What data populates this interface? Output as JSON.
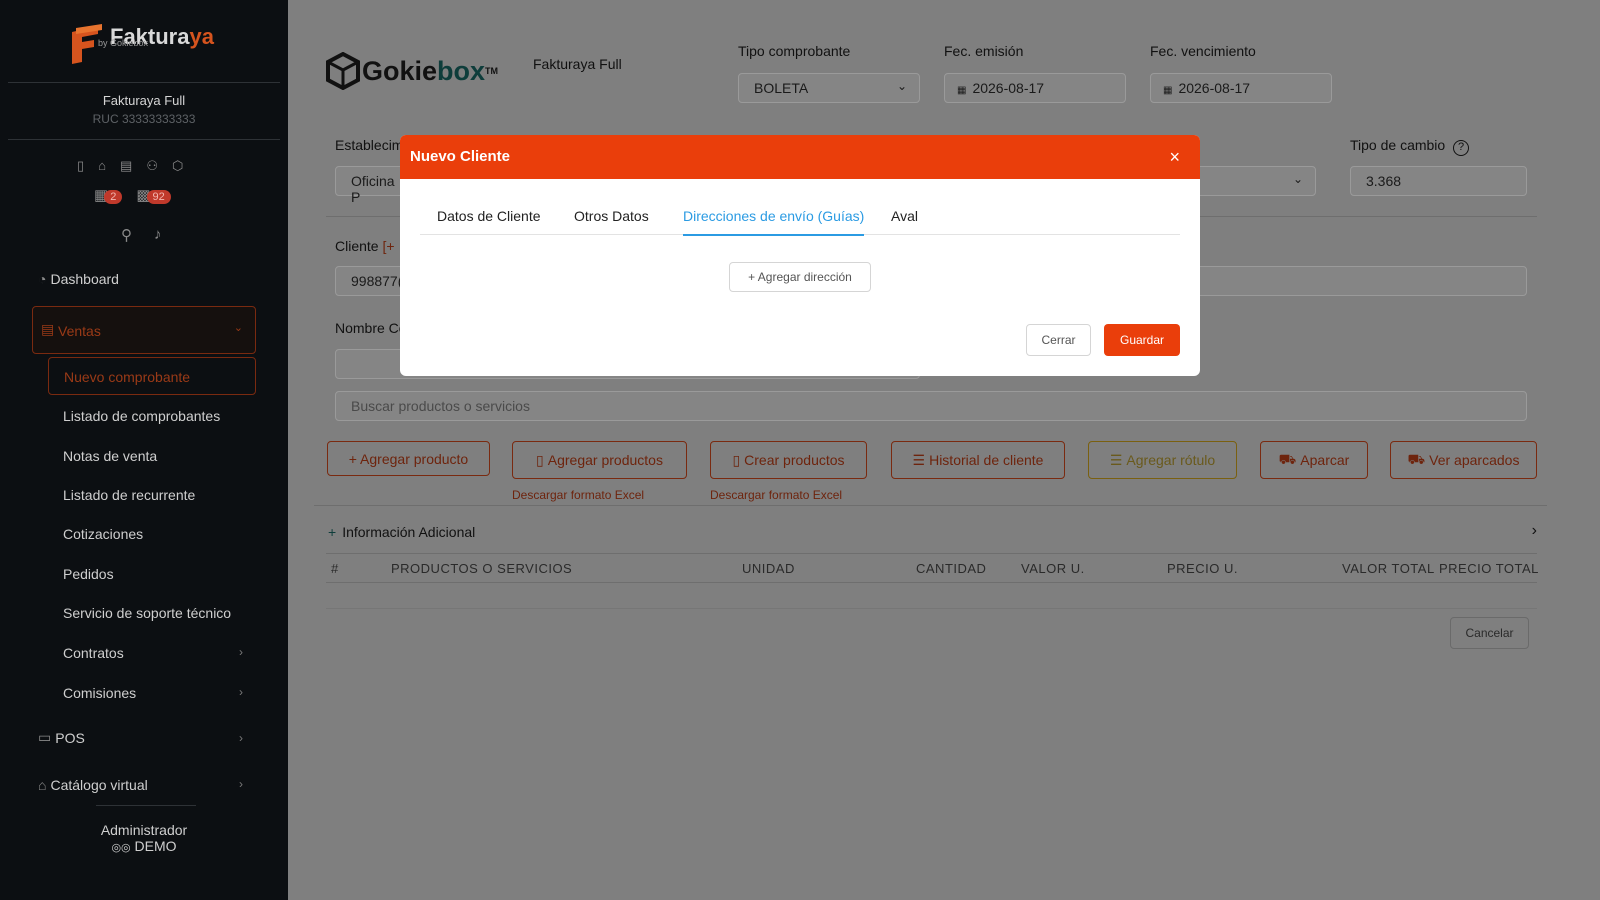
{
  "sidebar": {
    "brand": "Fakturaya",
    "brand_a": "Faktura",
    "brand_b": "ya",
    "brand_sub": "by Gokiebox",
    "company_name": "Fakturaya Full",
    "ruc": "RUC 33333333333",
    "badge_calendar": "2",
    "badge_box": "92",
    "menu": {
      "dashboard": "Dashboard",
      "ventas": "Ventas",
      "nuevo": "Nuevo comprobante",
      "listado": "Listado de comprobantes",
      "notas": "Notas de venta",
      "recurrente": "Listado de recurrente",
      "cotizaciones": "Cotizaciones",
      "pedidos": "Pedidos",
      "soporte": "Servicio de soporte técnico",
      "contratos": "Contratos",
      "comisiones": "Comisiones",
      "pos": "POS",
      "catalogo": "Catálogo virtual"
    },
    "user_role": "Administrador",
    "user_name": "DEMO"
  },
  "header": {
    "logo": "Gokiebox",
    "logo_a": "Gokie",
    "logo_b": "box",
    "tm": "TM",
    "company": "Fakturaya Full",
    "tipo_label": "Tipo comprobante",
    "tipo_value": "BOLETA",
    "emision_label": "Fec. emisión",
    "emision_value": "2026-08-17",
    "venc_label": "Fec. vencimiento",
    "venc_value": "2026-08-17"
  },
  "form": {
    "estab_label": "Establecim",
    "estab_value": "Oficina P",
    "cambio_label": "Tipo de cambio",
    "cambio_value": "3.368",
    "cliente_label": "Cliente",
    "cliente_add": "[+",
    "cliente_value": "998877(",
    "nombre_label": "Nombre Co",
    "search_placeholder": "Buscar productos o servicios"
  },
  "actions": {
    "agregar_producto": "+ Agregar producto",
    "agregar_productos": "Agregar productos",
    "crear_productos": "Crear productos",
    "historial": "Historial de cliente",
    "rotulo": "Agregar rótulo",
    "aparcar": "Aparcar",
    "ver_aparcados": "Ver aparcados",
    "excel1": "Descargar formato Excel",
    "excel2": "Descargar formato Excel"
  },
  "info_adicional": "Información Adicional",
  "table": {
    "headers": [
      "#",
      "PRODUCTOS O SERVICIOS",
      "UNIDAD",
      "CANTIDAD",
      "VALOR U.",
      "PRECIO U.",
      "VALOR TOTAL",
      "PRECIO TOTAL"
    ]
  },
  "cancelar": "Cancelar",
  "modal": {
    "title": "Nuevo Cliente",
    "close": "×",
    "tabs": [
      "Datos de Cliente",
      "Otros Datos",
      "Direcciones de envío (Guías)",
      "Aval"
    ],
    "add_address": "+ Agregar dirección",
    "cerrar": "Cerrar",
    "guardar": "Guardar"
  }
}
